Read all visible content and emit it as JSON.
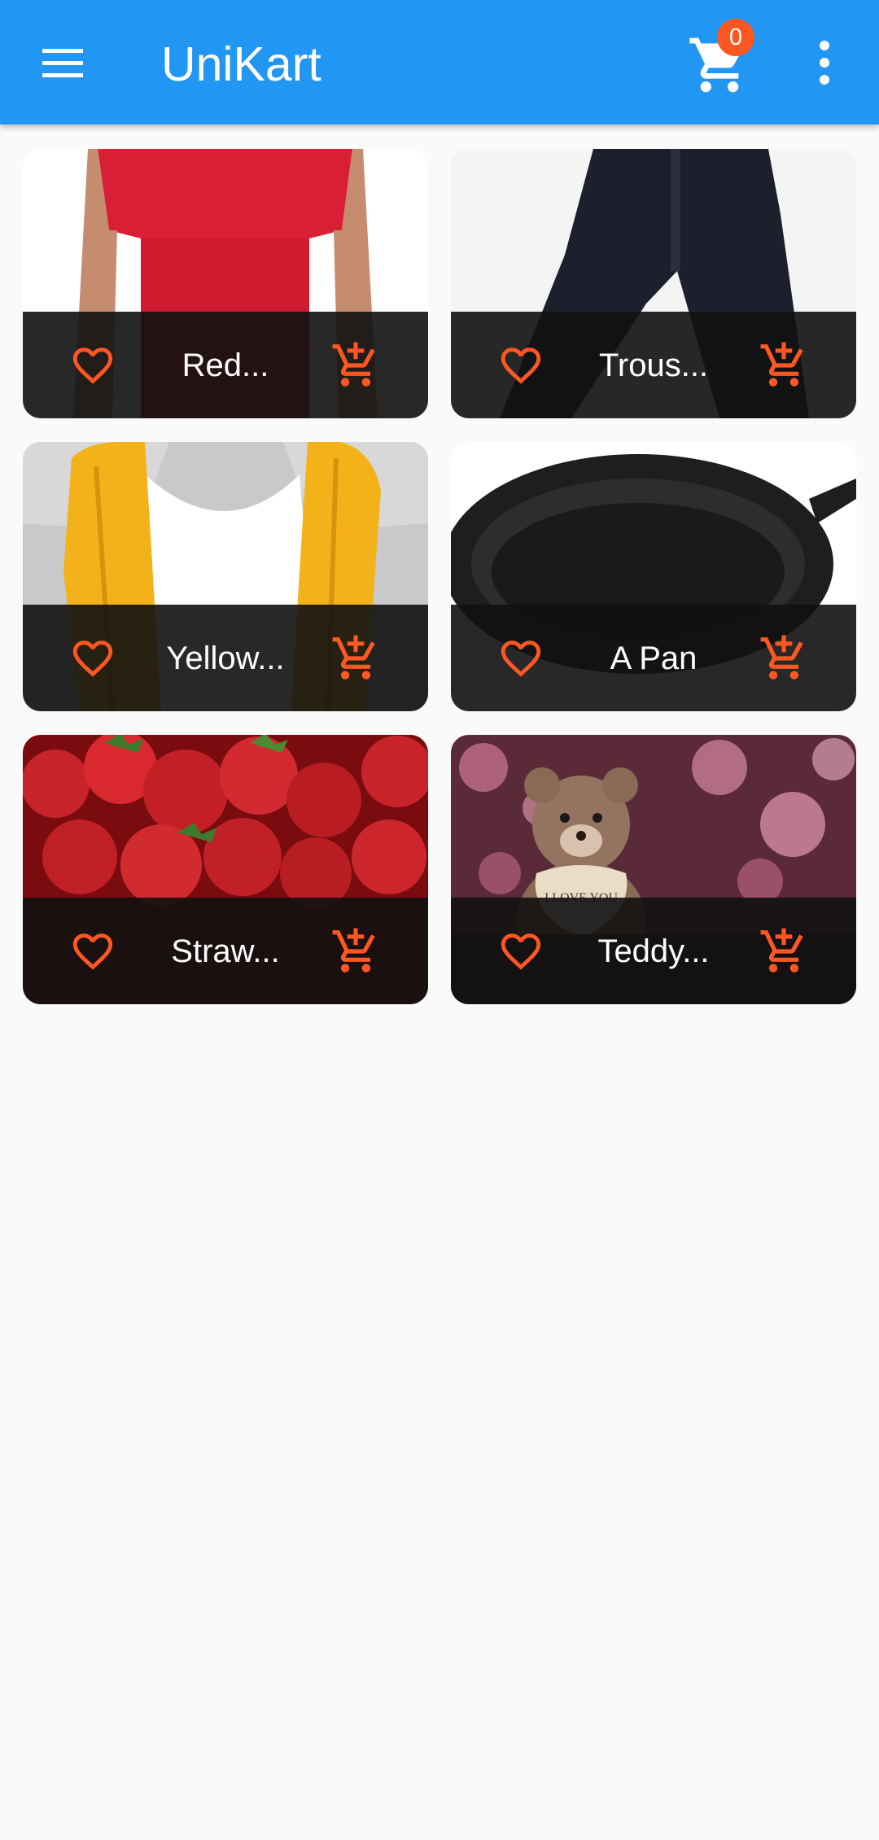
{
  "app": {
    "title": "UniKart",
    "cart_count": "0",
    "icons": {
      "menu": "menu-icon",
      "cart": "shopping-cart-icon",
      "more": "more-vertical-icon",
      "favorite": "heart-outline-icon",
      "add_to_cart": "add-shopping-cart-icon"
    }
  },
  "colors": {
    "app_bar": "#2196f3",
    "accent": "#ff5722",
    "footer_overlay": "#111111",
    "background": "#fafafa"
  },
  "products": [
    {
      "name": "Red...",
      "image": "red t-shirt"
    },
    {
      "name": "Trous...",
      "image": "dark trousers"
    },
    {
      "name": "Yellow...",
      "image": "yellow knit scarf"
    },
    {
      "name": "A Pan",
      "image": "cast iron pan"
    },
    {
      "name": "Straw...",
      "image": "strawberries"
    },
    {
      "name": "Teddy...",
      "image": "teddy bear holding heart",
      "image_text": "I LOVE YOU"
    }
  ]
}
